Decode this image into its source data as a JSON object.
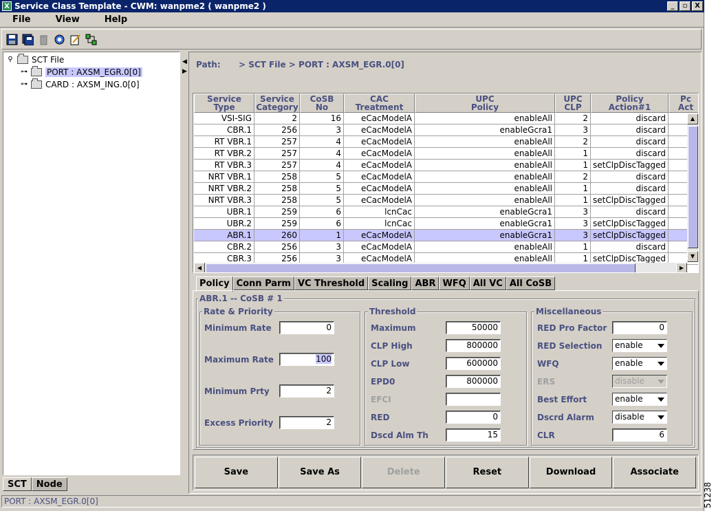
{
  "window": {
    "title": "Service Class Template - CWM: wanpme2 ( wanpme2 )",
    "app_icon": "X",
    "controls": [
      "_",
      "▫",
      "X"
    ]
  },
  "menu": [
    "File",
    "View",
    "Help"
  ],
  "toolbar": [
    "save-icon",
    "save-as-icon",
    "delete-icon",
    "refresh-icon",
    "edit-icon",
    "associate-icon"
  ],
  "tree": {
    "root": "SCT File",
    "children": [
      "PORT : AXSM_EGR.0[0]",
      "CARD : AXSM_ING.0[0]"
    ]
  },
  "left_tabs": [
    "SCT",
    "Node"
  ],
  "path": {
    "label": "Path:",
    "value": "> SCT File > PORT : AXSM_EGR.0[0]"
  },
  "table": {
    "columns": [
      "Service\nType",
      "Service\nCategory",
      "CoSB\nNo",
      "CAC\nTreatment",
      "UPC\nPolicy",
      "UPC\nCLP",
      "Policy\nAction#1",
      "Pc\nAct"
    ],
    "rows": [
      [
        "VSI-SIG",
        "2",
        "16",
        "eCacModelA",
        "enableAll",
        "2",
        "discard",
        ""
      ],
      [
        "CBR.1",
        "256",
        "3",
        "eCacModelA",
        "enableGcra1",
        "3",
        "discard",
        ""
      ],
      [
        "RT VBR.1",
        "257",
        "4",
        "eCacModelA",
        "enableAll",
        "2",
        "discard",
        ""
      ],
      [
        "RT VBR.2",
        "257",
        "4",
        "eCacModelA",
        "enableAll",
        "1",
        "discard",
        ""
      ],
      [
        "RT VBR.3",
        "257",
        "4",
        "eCacModelA",
        "enableAll",
        "1",
        "setClpDiscTagged",
        ""
      ],
      [
        "NRT VBR.1",
        "258",
        "5",
        "eCacModelA",
        "enableAll",
        "2",
        "discard",
        ""
      ],
      [
        "NRT VBR.2",
        "258",
        "5",
        "eCacModelA",
        "enableAll",
        "1",
        "discard",
        ""
      ],
      [
        "NRT VBR.3",
        "258",
        "5",
        "eCacModelA",
        "enableAll",
        "1",
        "setClpDiscTagged",
        ""
      ],
      [
        "UBR.1",
        "259",
        "6",
        "lcnCac",
        "enableGcra1",
        "3",
        "discard",
        ""
      ],
      [
        "UBR.2",
        "259",
        "6",
        "lcnCac",
        "enableGcra1",
        "3",
        "setClpDiscTagged",
        ""
      ],
      [
        "ABR.1",
        "260",
        "1",
        "eCacModelA",
        "enableGcra1",
        "3",
        "setClpDiscTagged",
        ""
      ],
      [
        "CBR.2",
        "256",
        "3",
        "eCacModelA",
        "enableAll",
        "1",
        "discard",
        ""
      ],
      [
        "CBR.3",
        "256",
        "3",
        "eCacModelA",
        "enableAll",
        "1",
        "setClpDiscTagged",
        ""
      ]
    ],
    "selected_row": 10
  },
  "tabs": [
    "Policy",
    "Conn Parm",
    "VC Threshold",
    "Scaling",
    "ABR",
    "WFQ",
    "All VC",
    "All CoSB"
  ],
  "policy": {
    "title": "ABR.1 -- CoSB # 1",
    "rate_priority": {
      "title": "Rate & Priority",
      "fields": [
        {
          "label": "Minimum Rate",
          "value": "0"
        },
        {
          "label": "Maximum Rate",
          "value": "100"
        },
        {
          "label": "Minimum Prty",
          "value": "2"
        },
        {
          "label": "Excess Priority",
          "value": "2"
        }
      ]
    },
    "threshold": {
      "title": "Threshold",
      "fields": [
        {
          "label": "Maximum",
          "value": "50000"
        },
        {
          "label": "CLP High",
          "value": "800000"
        },
        {
          "label": "CLP Low",
          "value": "600000"
        },
        {
          "label": "EPD0",
          "value": "800000"
        },
        {
          "label": "EFCI",
          "value": ""
        },
        {
          "label": "RED",
          "value": "0"
        },
        {
          "label": "Dscd Alm Th",
          "value": "15"
        }
      ]
    },
    "misc": {
      "title": "Miscellaneous",
      "fields": [
        {
          "label": "RED Pro Factor",
          "value": "0"
        },
        {
          "label": "RED Selection",
          "value": "enable"
        },
        {
          "label": "WFQ",
          "value": "enable"
        },
        {
          "label": "ERS",
          "value": "disable"
        },
        {
          "label": "Best Effort",
          "value": "enable"
        },
        {
          "label": "Dscrd Alarm",
          "value": "disable"
        },
        {
          "label": "CLR",
          "value": "6"
        }
      ]
    }
  },
  "actions": [
    "Save",
    "Save As",
    "Delete",
    "Reset",
    "Download",
    "Associate"
  ],
  "status": "PORT : AXSM_EGR.0[0]",
  "figure_id": "51238"
}
